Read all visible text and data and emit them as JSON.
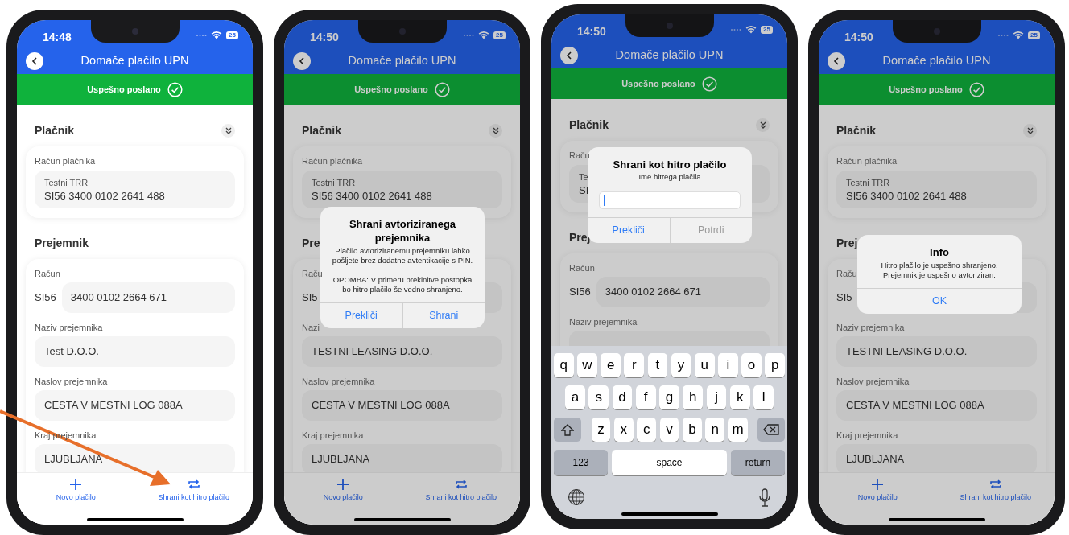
{
  "phones": [
    {
      "time": "14:48",
      "battery": "25",
      "title": "Domače plačilo UPN",
      "banner": "Uspešno poslano",
      "dimmed": false,
      "sections": [
        {
          "title": "Plačnik",
          "collapsible": true,
          "items": [
            {
              "kind": "account",
              "label": "Račun plačnika",
              "caption": "Testni TRR",
              "value": "SI56 3400 0102 2641 488"
            }
          ]
        },
        {
          "title": "Prejemnik",
          "collapsible": false,
          "items": [
            {
              "kind": "prefixed",
              "label": "Račun",
              "prefix": "SI56",
              "value": "3400 0102 2664 671"
            },
            {
              "kind": "text",
              "label": "Naziv prejemnika",
              "value": "Test D.O.O."
            },
            {
              "kind": "text",
              "label": "Naslov prejemnika",
              "value": "CESTA V MESTNI LOG 088A"
            },
            {
              "kind": "text",
              "label": "Kraj prejemnika",
              "value": "LJUBLJANA"
            }
          ]
        }
      ],
      "bottom_bar": [
        {
          "kind": "add",
          "label": "Novo plačilo"
        },
        {
          "kind": "save",
          "label": "Shrani kot hitro plačilo"
        }
      ]
    },
    {
      "time": "14:50",
      "battery": "25",
      "title": "Domače plačilo UPN",
      "banner": "Uspešno poslano",
      "dimmed": true,
      "sections": [
        {
          "title": "Plačnik",
          "collapsible": true,
          "items": [
            {
              "kind": "account",
              "label": "Račun plačnika",
              "caption": "Testni TRR",
              "value": "SI56 3400 0102 2641 488"
            }
          ]
        },
        {
          "title": "Pre",
          "collapsible": false,
          "items": [
            {
              "kind": "prefixed",
              "label": "Raču",
              "prefix": "SI5"
            },
            {
              "kind": "text",
              "label": "Nazi",
              "value": "TESTNI LEASING D.O.O."
            },
            {
              "kind": "text",
              "label": "Naslov prejemnika",
              "value": "CESTA V MESTNI LOG 088A"
            },
            {
              "kind": "text",
              "label": "Kraj prejemnika",
              "value": "LJUBLJANA"
            }
          ]
        }
      ],
      "bottom_bar": [
        {
          "kind": "add",
          "label": "Novo plačilo"
        },
        {
          "kind": "save",
          "label": "Shrani kot hitro plačilo"
        }
      ],
      "dialog": {
        "kind": "alert",
        "title": "Shrani avtoriziranega prejemnika",
        "message": "Plačilo avtoriziranemu prejemniku lahko pošljete brez dodatne avtentikacije s PIN.\n\nOPOMBA: V primeru prekinitve postopka bo hitro plačilo še vedno shranjeno.",
        "buttons": [
          {
            "label": "Prekliči",
            "disabled": false
          },
          {
            "label": "Shrani",
            "disabled": false
          }
        ]
      }
    },
    {
      "time": "14:50",
      "battery": "25",
      "title": "Domače plačilo UPN",
      "banner": "Uspešno poslano",
      "dimmed": true,
      "sections": [
        {
          "title": "Plačnik",
          "collapsible": true,
          "items": [
            {
              "kind": "account",
              "label": "Raču",
              "caption": "Te",
              "value": "SI"
            }
          ]
        },
        {
          "title": "Prej",
          "collapsible": false,
          "items": [
            {
              "kind": "prefixed",
              "label": "Račun",
              "prefix": "SI56",
              "value": "3400 0102 2664 671"
            },
            {
              "kind": "text",
              "label": "Naziv prejemnika"
            }
          ]
        }
      ],
      "dialog": {
        "kind": "prompt",
        "title": "Shrani kot hitro plačilo",
        "message": "Ime hitrega plačila",
        "field": {
          "focused": true
        },
        "buttons": [
          {
            "label": "Prekliči",
            "disabled": false
          },
          {
            "label": "Potrdi",
            "disabled": true
          }
        ]
      },
      "keyboard": {
        "rows": [
          [
            "q",
            "w",
            "e",
            "r",
            "t",
            "y",
            "u",
            "i",
            "o",
            "p"
          ],
          [
            "a",
            "s",
            "d",
            "f",
            "g",
            "h",
            "j",
            "k",
            "l"
          ],
          [
            "z",
            "x",
            "c",
            "v",
            "b",
            "n",
            "m"
          ]
        ],
        "bottom_row": [
          "123",
          "space",
          "return"
        ]
      }
    },
    {
      "time": "14:50",
      "battery": "25",
      "title": "Domače plačilo UPN",
      "banner": "Uspešno poslano",
      "dimmed": true,
      "sections": [
        {
          "title": "Plačnik",
          "collapsible": true,
          "items": [
            {
              "kind": "account",
              "label": "Račun plačnika",
              "caption": "Testni TRR",
              "value": "SI56 3400 0102 2641 488"
            }
          ]
        },
        {
          "title": "Prej",
          "collapsible": false,
          "items": [
            {
              "kind": "prefixed",
              "label": "Raču",
              "prefix": "SI5"
            },
            {
              "kind": "text",
              "label": "Naziv prejemnika",
              "value": "TESTNI LEASING D.O.O."
            },
            {
              "kind": "text",
              "label": "Naslov prejemnika",
              "value": "CESTA V MESTNI LOG 088A"
            },
            {
              "kind": "text",
              "label": "Kraj prejemnika",
              "value": "LJUBLJANA"
            }
          ]
        }
      ],
      "bottom_bar": [
        {
          "kind": "add",
          "label": "Novo plačilo"
        },
        {
          "kind": "save",
          "label": "Shrani kot hitro plačilo"
        }
      ],
      "dialog": {
        "kind": "alert",
        "title": "Info",
        "message": "Hitro plačilo je uspešno shranjeno. Prejemnik je uspešno avtoriziran.",
        "buttons": [
          {
            "label": "OK",
            "disabled": false
          }
        ]
      }
    }
  ]
}
